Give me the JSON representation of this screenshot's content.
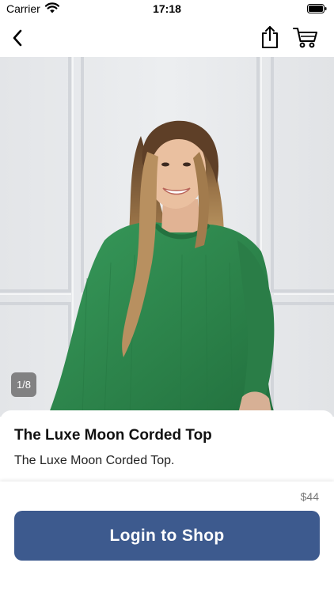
{
  "status_bar": {
    "carrier": "Carrier",
    "time": "17:18"
  },
  "nav": {
    "back_icon": "chevron-left-icon",
    "share_icon": "share-icon",
    "cart_icon": "cart-icon"
  },
  "product": {
    "image_description": "model wearing green corded top",
    "image_counter": "1/8",
    "title": "The Luxe Moon Corded Top",
    "description": "The Luxe Moon Corded Top.",
    "price": "$44"
  },
  "footer": {
    "cta_label": "Login to Shop"
  },
  "colors": {
    "accent": "#3d5a8e",
    "garment": "#2f8a4e"
  }
}
